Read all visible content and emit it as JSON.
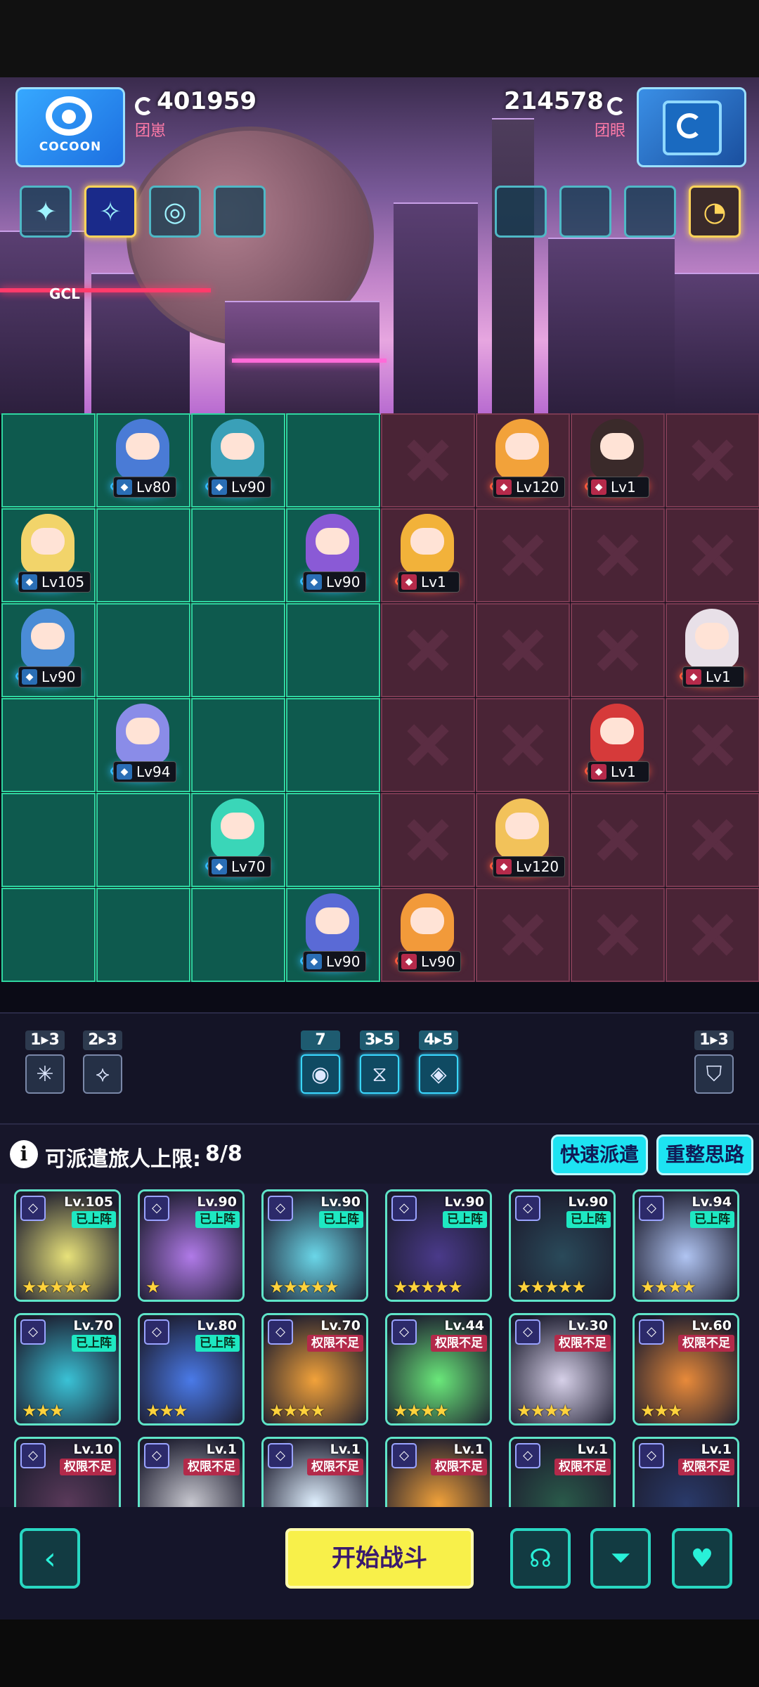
{
  "header": {
    "player": {
      "logo_text": "COCOON",
      "score": "401959",
      "sub": "团崽"
    },
    "opponent": {
      "score": "214578",
      "sub": "团眼"
    },
    "gcl_text": "GCL"
  },
  "board_units": {
    "u1": "Lv80",
    "u2": "Lv90",
    "u3": "Lv105",
    "u4": "Lv90",
    "u5": "Lv90",
    "u6": "Lv94",
    "u7": "Lv70",
    "u8": "Lv90",
    "e1": "Lv120",
    "e2": "Lv1",
    "e3": "Lv1",
    "e4": "Lv1",
    "e5": "Lv1",
    "e6": "Lv120",
    "e7": "Lv90"
  },
  "factions": {
    "f1": "1▸3",
    "f2": "2▸3",
    "f3": "7",
    "f4": "3▸5",
    "f5": "4▸5",
    "f6": "1▸3"
  },
  "deploy": {
    "label": "可派遣旅人上限:",
    "count": "8/8",
    "quick_btn": "快速派遣",
    "reset_btn": "重整思路"
  },
  "roster": [
    {
      "lv": "Lv.105",
      "tag": "已上阵",
      "stars": "★★★★★"
    },
    {
      "lv": "Lv.90",
      "tag": "已上阵",
      "stars": "★"
    },
    {
      "lv": "Lv.90",
      "tag": "已上阵",
      "stars": "★★★★★"
    },
    {
      "lv": "Lv.90",
      "tag": "已上阵",
      "stars": "★★★★★"
    },
    {
      "lv": "Lv.90",
      "tag": "已上阵",
      "stars": "★★★★★"
    },
    {
      "lv": "Lv.94",
      "tag": "已上阵",
      "stars": "★★★★"
    },
    {
      "lv": "Lv.70",
      "tag": "已上阵",
      "stars": "★★★"
    },
    {
      "lv": "Lv.80",
      "tag": "已上阵",
      "stars": "★★★"
    },
    {
      "lv": "Lv.70",
      "tag": "权限不足",
      "stars": "★★★★"
    },
    {
      "lv": "Lv.44",
      "tag": "权限不足",
      "stars": "★★★★"
    },
    {
      "lv": "Lv.30",
      "tag": "权限不足",
      "stars": "★★★★"
    },
    {
      "lv": "Lv.60",
      "tag": "权限不足",
      "stars": "★★★"
    },
    {
      "lv": "Lv.10",
      "tag": "权限不足",
      "stars": ""
    },
    {
      "lv": "Lv.1",
      "tag": "权限不足",
      "stars": ""
    },
    {
      "lv": "Lv.1",
      "tag": "权限不足",
      "stars": ""
    },
    {
      "lv": "Lv.1",
      "tag": "权限不足",
      "stars": ""
    },
    {
      "lv": "Lv.1",
      "tag": "权限不足",
      "stars": ""
    },
    {
      "lv": "Lv.1",
      "tag": "权限不足",
      "stars": ""
    }
  ],
  "bottom": {
    "start_btn": "开始战斗"
  },
  "colors": {
    "ally_tile": "#0e5a4e",
    "enemy_tile": "#4a2436",
    "start": "#f8f04a",
    "accent": "#1de3f2"
  }
}
